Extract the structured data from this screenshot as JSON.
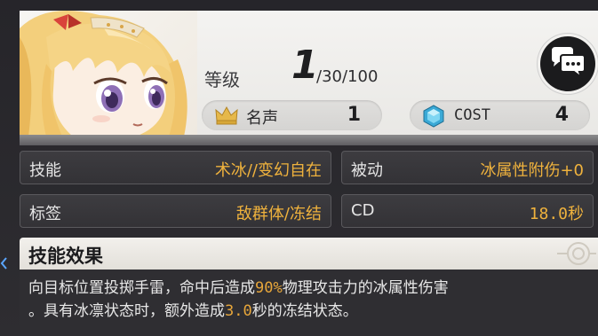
{
  "header": {
    "level_label": "等级",
    "level_value": "1",
    "level_max": "/30/100",
    "fame": {
      "label": "名声",
      "value": "1",
      "icon": "crown-icon"
    },
    "cost": {
      "label": "COST",
      "value": "4",
      "icon": "crystal-icon"
    },
    "chat_icon": "chat-bubble-icon"
  },
  "info": {
    "skill": {
      "key": "技能",
      "value": "术冰//变幻自在"
    },
    "passive": {
      "key": "被动",
      "value": "冰属性附伤+0"
    },
    "tag": {
      "key": "标签",
      "value": "敌群体/冻结"
    },
    "cd": {
      "key": "CD",
      "value": "18.0秒"
    }
  },
  "effect": {
    "title": "技能效果",
    "line1_a": "向目标位置投掷手雷，命中后造成",
    "line1_hl": "90%",
    "line1_b": "物理攻击力的冰属性伤害",
    "line2_a": "。具有冰凛状态时，额外造成",
    "line2_hl": "3.0",
    "line2_b": "秒的冻结状态。"
  },
  "colors": {
    "accent": "#efb23d",
    "highlight": "#e7a63a",
    "panel_bg": "#333236",
    "card_bg": "#f0efec"
  }
}
